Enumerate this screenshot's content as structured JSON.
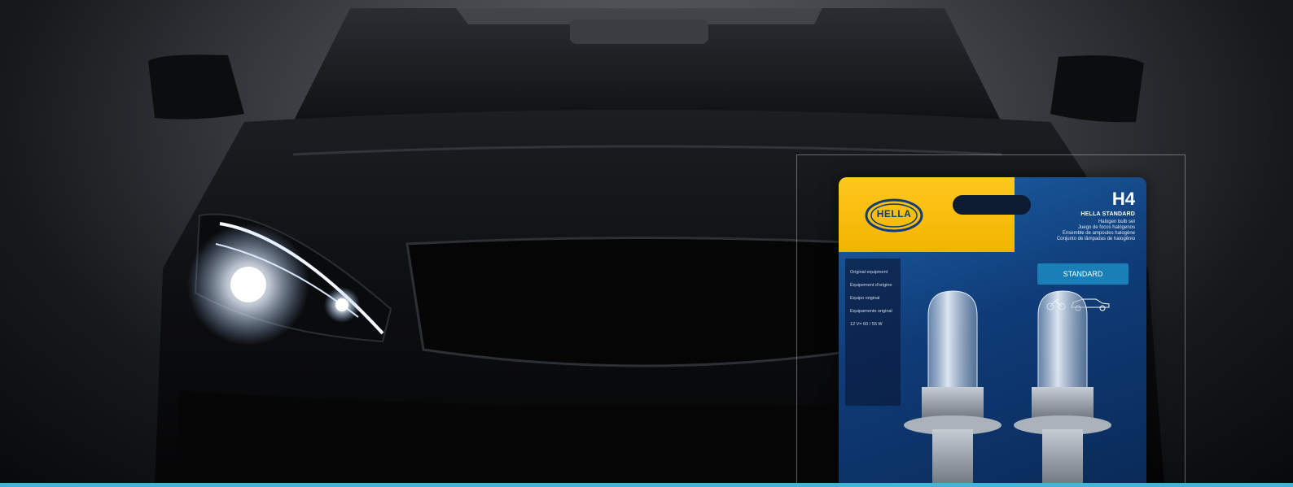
{
  "pack": {
    "brand": "HELLA",
    "model": "H4",
    "product_line": "HELLA STANDARD",
    "descriptions": [
      "Halogen bulb set",
      "Juego de focos halógenos",
      "Ensemble de ampoules halogène",
      "Conjunto de lâmpadas de halogênio"
    ],
    "badge": "STANDARD",
    "side_panel": [
      "Original equipment",
      "Équipement d'origine",
      "Equipo original",
      "Equipamento original",
      "12 V= 60 / 55 W"
    ]
  },
  "colors": {
    "accent_bar": "#3fb6d8",
    "pack_blue": "#0f3c78",
    "pack_yellow": "#ffc81e"
  },
  "icons": [
    "headlight-glow",
    "hella-logo",
    "motorcycle-icon",
    "car-icon",
    "bulb-icon"
  ]
}
